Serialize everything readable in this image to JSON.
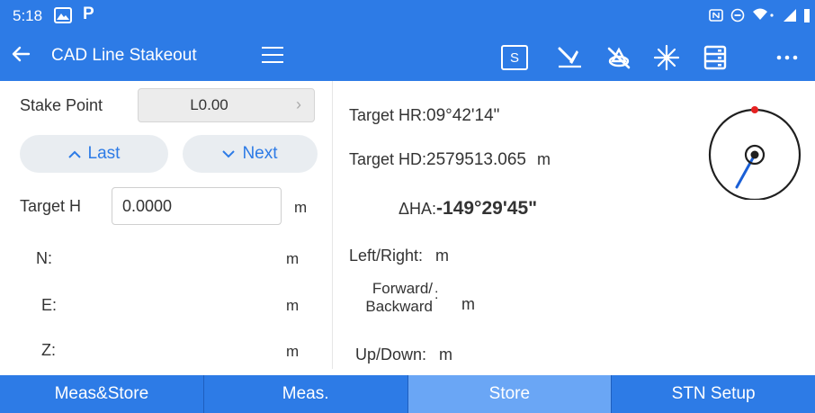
{
  "status_bar": {
    "time": "5:18",
    "icons": [
      "gallery-icon",
      "parking-app-icon",
      "nfc-icon",
      "dnd-icon",
      "wifi-icon",
      "signal-icon",
      "battery-icon"
    ]
  },
  "toolbar": {
    "title": "CAD Line Stakeout",
    "s_label": "S",
    "icons": [
      "back-arrow-icon",
      "hamburger-menu-icon",
      "s-box-icon",
      "laser-pointer-icon",
      "no-prism-icon",
      "sparkle-icon",
      "list-icon",
      "more-icon"
    ]
  },
  "left": {
    "stake_point_label": "Stake Point",
    "stake_point_value": "L0.00",
    "last_label": "Last",
    "next_label": "Next",
    "target_h_label": "Target H",
    "target_h_value": "0.0000",
    "target_h_unit": "m",
    "n_label": "N:",
    "n_unit": "m",
    "e_label": "E:",
    "e_unit": "m",
    "z_label": "Z:",
    "z_unit": "m"
  },
  "right": {
    "target_hr_label": "Target HR:",
    "target_hr_value": "09°42'14\"",
    "target_hd_label": "Target HD:",
    "target_hd_value": "2579513.065",
    "target_hd_unit": "m",
    "dha_label": "ΔHA:",
    "dha_value": "-149°29'45\"",
    "left_right_label": "Left/Right:",
    "left_right_unit": "m",
    "forward_label_1": "Forward/",
    "forward_label_2": "Backward",
    "forward_colon": ":",
    "forward_unit": "m",
    "up_down_label": "Up/Down:",
    "up_down_unit": "m"
  },
  "bottom_bar": {
    "buttons": [
      "Meas&Store",
      "Meas.",
      "Store",
      "STN Setup"
    ],
    "active_index": 2
  },
  "colors": {
    "primary": "#2d7be6",
    "active_tab": "#6aa6f5",
    "compass_needle": "#1a5fd6",
    "compass_north": "#e52222"
  }
}
